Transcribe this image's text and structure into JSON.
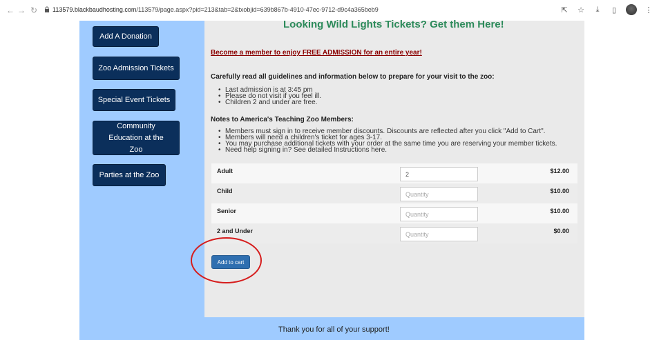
{
  "browser": {
    "url_host": "113579.blackbaudhosting.com",
    "url_path": "/113579/page.aspx?pid=213&tab=2&txobjid=639b867b-4910-47ec-9712-d9c4a365beb9"
  },
  "sidebar": {
    "buttons": [
      "Add A Donation",
      "Zoo Admission Tickets",
      "Special Event Tickets",
      "Community Education at the Zoo",
      "Parties at the Zoo"
    ]
  },
  "main": {
    "heading": "Looking Wild Lights Tickets? Get them Here!",
    "member_link": "Become a member to enjoy FREE ADMISSION for an entire year!",
    "guidelines_heading": "Carefully read all guidelines and information below to prepare for your visit to the zoo:",
    "guidelines": [
      "Last admission is at 3:45 pm",
      "Please do not visit if you feel ill.",
      "Children 2 and under are free."
    ],
    "notes_heading": "Notes to America's Teaching Zoo Members:",
    "notes": [
      "Members must sign in to receive member discounts. Discounts are reflected after you click \"Add to Cart\".",
      "Members will need a children's ticket for ages 3-17.",
      "You may purchase additional tickets with your order at the same time you are reserving your member tickets.",
      "Need help signing in? See detailed Instructions here."
    ]
  },
  "tickets": [
    {
      "label": "Adult",
      "value": "2",
      "placeholder": "Quantity",
      "price": "$12.00"
    },
    {
      "label": "Child",
      "value": "",
      "placeholder": "Quantity",
      "price": "$10.00"
    },
    {
      "label": "Senior",
      "value": "",
      "placeholder": "Quantity",
      "price": "$10.00"
    },
    {
      "label": "2 and Under",
      "value": "",
      "placeholder": "Quantity",
      "price": "$0.00"
    }
  ],
  "cart": {
    "label": "Add to cart"
  },
  "footer": {
    "text": "Thank you for all of your support!"
  },
  "colors": {
    "sidebar": "#9fcbff",
    "button": "#0b2f5b",
    "heading": "#2c8a5a",
    "link": "#8b0000",
    "highlight": "#d61d1d"
  }
}
